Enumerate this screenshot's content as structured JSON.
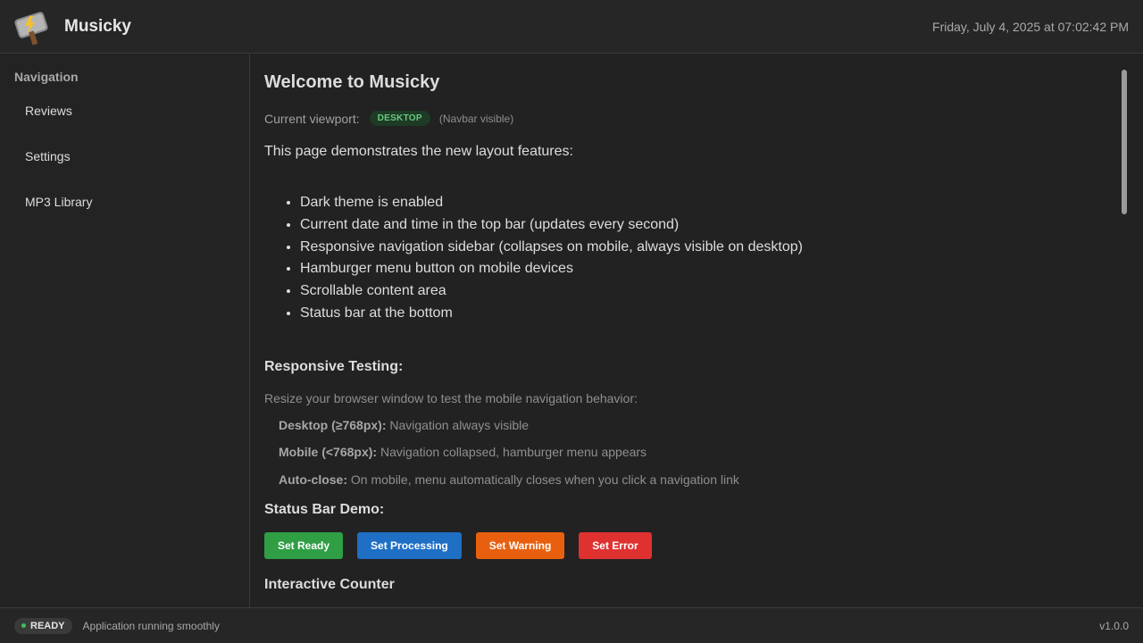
{
  "header": {
    "app_title": "Musicky",
    "logo_icon": "hammer-lightning-icon",
    "datetime": "Friday, July 4, 2025 at 07:02:42 PM"
  },
  "sidebar": {
    "heading": "Navigation",
    "items": [
      {
        "label": "Reviews"
      },
      {
        "label": "Settings"
      },
      {
        "label": "MP3 Library"
      }
    ]
  },
  "main": {
    "title": "Welcome to Musicky",
    "viewport": {
      "label": "Current viewport:",
      "badge": "DESKTOP",
      "note": "(Navbar visible)"
    },
    "intro": "This page demonstrates the new layout features:",
    "features": [
      "Dark theme is enabled",
      "Current date and time in the top bar (updates every second)",
      "Responsive navigation sidebar (collapses on mobile, always visible on desktop)",
      "Hamburger menu button on mobile devices",
      "Scrollable content area",
      "Status bar at the bottom"
    ],
    "responsive": {
      "heading": "Responsive Testing:",
      "hint": "Resize your browser window to test the mobile navigation behavior:",
      "rows": [
        {
          "key": "Desktop (≥768px):",
          "value": " Navigation always visible"
        },
        {
          "key": "Mobile (<768px):",
          "value": " Navigation collapsed, hamburger menu appears"
        },
        {
          "key": "Auto-close:",
          "value": " On mobile, menu automatically closes when you click a navigation link"
        }
      ]
    },
    "status_demo": {
      "heading": "Status Bar Demo:",
      "buttons": {
        "ready": "Set Ready",
        "processing": "Set Processing",
        "warning": "Set Warning",
        "error": "Set Error"
      }
    },
    "next_heading": "Interactive Counter"
  },
  "statusbar": {
    "state": "READY",
    "message": "Application running smoothly",
    "version": "v1.0.0"
  },
  "colors": {
    "ready": "#2f9e44",
    "processing": "#1f6fc5",
    "warning": "#e8600f",
    "error": "#e03131"
  }
}
